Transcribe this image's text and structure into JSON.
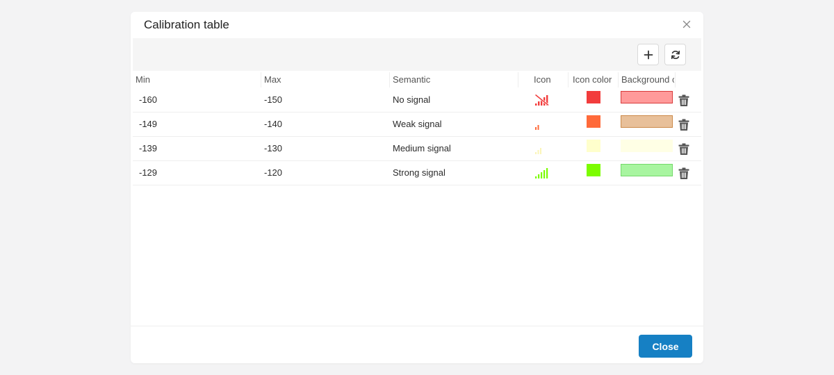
{
  "dialog": {
    "title": "Calibration table",
    "close_button": "Close"
  },
  "toolbar": {
    "add_icon": "plus-icon",
    "refresh_icon": "refresh-icon"
  },
  "columns": [
    "Min",
    "Max",
    "Semantic",
    "Icon",
    "Icon color",
    "Background c"
  ],
  "rows": [
    {
      "min": "-160",
      "max": "-150",
      "semantic": "No signal",
      "icon": "no-signal-icon",
      "icon_color": "#f23c3c",
      "bg_fill": "#ff9a9a",
      "bg_border": "#d83a3a",
      "signal_bars": 0
    },
    {
      "min": "-149",
      "max": "-140",
      "semantic": "Weak signal",
      "icon": "weak-signal-icon",
      "icon_color": "#ff6a3a",
      "bg_fill": "#e8c09a",
      "bg_border": "#cc8a4a",
      "signal_bars": 1
    },
    {
      "min": "-139",
      "max": "-130",
      "semantic": "Medium signal",
      "icon": "medium-signal-icon",
      "icon_color": "#ffffcc",
      "bg_fill": "#ffffe5",
      "bg_border": "#ffffe5",
      "signal_bars": 2
    },
    {
      "min": "-129",
      "max": "-120",
      "semantic": "Strong signal",
      "icon": "strong-signal-icon",
      "icon_color": "#7cfc00",
      "bg_fill": "#a8f5a0",
      "bg_border": "#74d86a",
      "signal_bars": 5
    }
  ],
  "colors": {
    "primary_button": "#1680c4",
    "delete_icon": "#555555"
  }
}
